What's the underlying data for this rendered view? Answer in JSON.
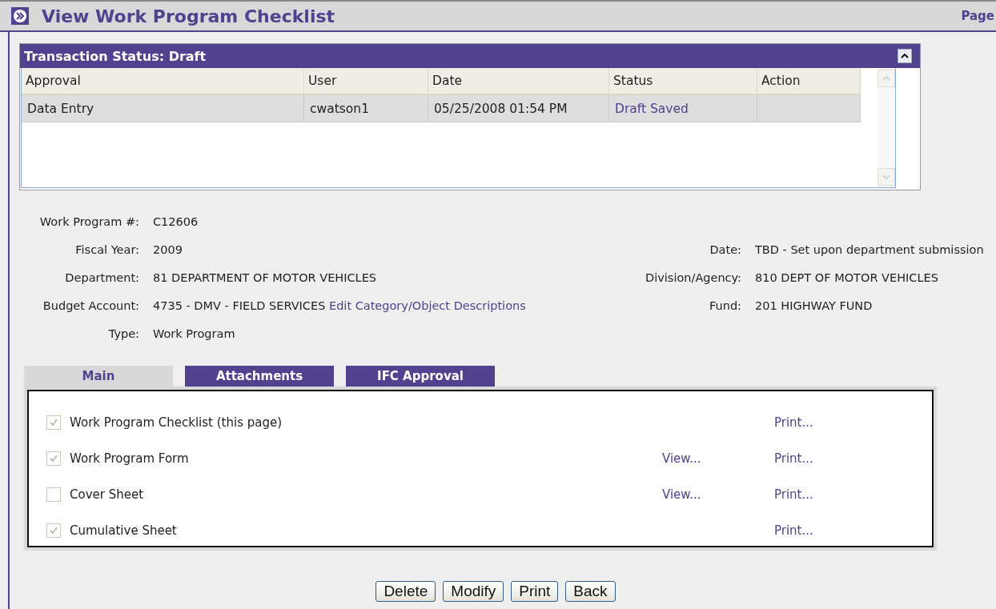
{
  "page": {
    "title": "View Work Program Checklist",
    "top_link": "Page"
  },
  "transaction": {
    "title": "Transaction Status: Draft",
    "expanded": true,
    "columns": [
      "Approval",
      "User",
      "Date",
      "Status",
      "Action"
    ],
    "rows": [
      {
        "approval": "Data Entry",
        "user": "cwatson1",
        "date": "05/25/2008 01:54 PM",
        "status": "Draft Saved",
        "action": ""
      }
    ]
  },
  "fields": [
    {
      "label": "Work Program #:",
      "value": "C12606"
    },
    {
      "label": "Fiscal Year:",
      "value": "2009",
      "right_label": "Date:",
      "right_value": "TBD - Set upon department submission"
    },
    {
      "label": "Department:",
      "value": "81 DEPARTMENT OF MOTOR VEHICLES",
      "right_label": "Division/Agency:",
      "right_value": "810 DEPT OF MOTOR VEHICLES"
    },
    {
      "label": "Budget Account:",
      "value": "4735 - DMV - FIELD SERVICES",
      "link": "Edit Category/Object Descriptions",
      "right_label": "Fund:",
      "right_value": "201 HIGHWAY FUND"
    },
    {
      "label": "Type:",
      "value": "Work Program"
    }
  ],
  "tabs": [
    {
      "label": "Main",
      "selected": true
    },
    {
      "label": "Attachments",
      "selected": false
    },
    {
      "label": "IFC Approval",
      "selected": false
    }
  ],
  "checklist": [
    {
      "label": "Work Program Checklist (this page)",
      "checked": true,
      "disabled": true,
      "print": "Print..."
    },
    {
      "label": "Work Program Form",
      "checked": true,
      "disabled": true,
      "view": "View...",
      "print": "Print..."
    },
    {
      "label": "Cover Sheet",
      "checked": false,
      "disabled": true,
      "view": "View...",
      "print": "Print..."
    },
    {
      "label": "Cumulative Sheet",
      "checked": true,
      "disabled": true,
      "print": "Print..."
    }
  ],
  "buttons": [
    "Delete",
    "Modify",
    "Print",
    "Back"
  ]
}
